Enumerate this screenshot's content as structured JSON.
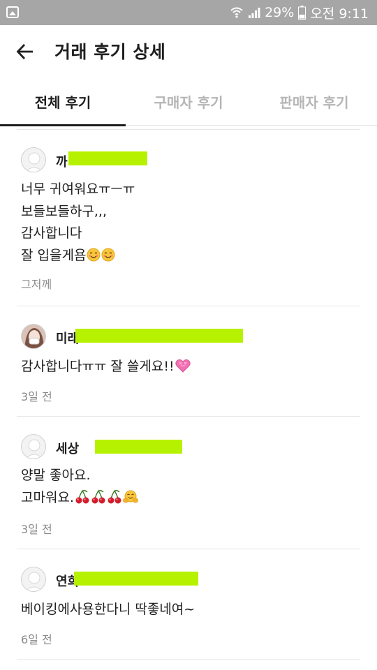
{
  "status_bar": {
    "battery": "29%",
    "time": "오전 9:11",
    "icons": [
      "gallery-icon",
      "wifi-icon",
      "signal-icon",
      "battery-icon"
    ]
  },
  "header": {
    "back_icon": "arrow-left-icon",
    "title": "거래 후기 상세"
  },
  "tabs": [
    {
      "label": "전체 후기",
      "active": true
    },
    {
      "label": "구매자 후기",
      "active": false
    },
    {
      "label": "판매자 후기",
      "active": false
    }
  ],
  "reviews": [
    {
      "name": "까",
      "lines": [
        "너무 귀여워요ㅠㅡㅠ",
        "보들보들하구,,,",
        "감사합니다",
        "잘 입을게욤"
      ],
      "emojis": [
        "smiling-face",
        "smiling-face"
      ],
      "time": "그저께"
    },
    {
      "name": "미래",
      "lines": [
        "감사합니다ㅠㅠ 잘 쓸게요!!"
      ],
      "emojis": [
        "pink-heart"
      ],
      "time": "3일 전"
    },
    {
      "name": "세상",
      "lines": [
        "양말 좋아요.",
        "고마워요."
      ],
      "emojis": [
        "cherries",
        "cherries",
        "cherries",
        "hugging-face"
      ],
      "time": "3일 전"
    },
    {
      "name": "연희",
      "lines": [
        "베이킹에사용한다니 딱좋네여~"
      ],
      "emojis": [],
      "time": "6일 전"
    }
  ],
  "colors": {
    "status_bar": "#a6a6a6",
    "redaction_highlight": "#b6f200",
    "muted_text": "#8a8a8a",
    "inactive_tab": "#b5b5b5"
  }
}
